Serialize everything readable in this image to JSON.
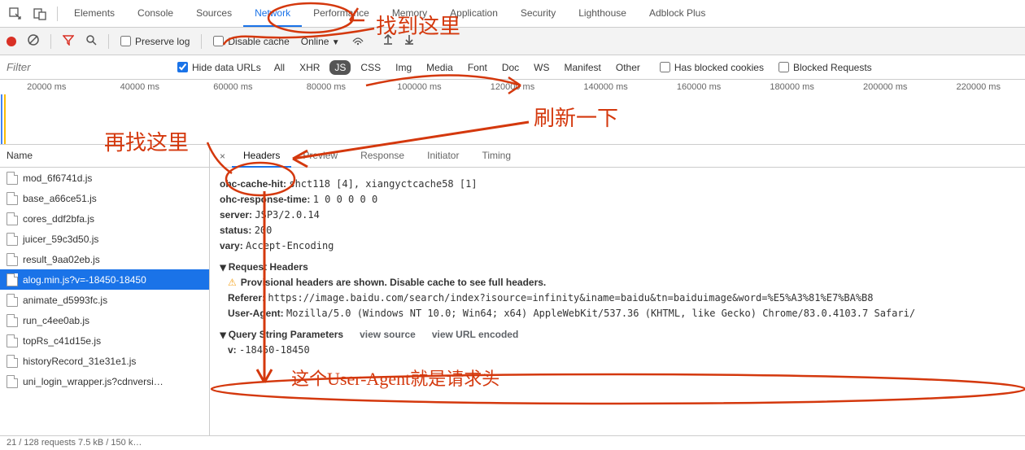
{
  "top_tabs": {
    "tabs": [
      "Elements",
      "Console",
      "Sources",
      "Network",
      "Performance",
      "Memory",
      "Application",
      "Security",
      "Lighthouse",
      "Adblock Plus"
    ],
    "active": "Network"
  },
  "toolbar": {
    "preserve_log": "Preserve log",
    "disable_cache": "Disable cache",
    "online": "Online"
  },
  "filter": {
    "placeholder": "Filter",
    "hide_data_urls": "Hide data URLs",
    "types": [
      "All",
      "XHR",
      "JS",
      "CSS",
      "Img",
      "Media",
      "Font",
      "Doc",
      "WS",
      "Manifest",
      "Other"
    ],
    "selected_type": "JS",
    "has_blocked_cookies": "Has blocked cookies",
    "blocked_requests": "Blocked Requests"
  },
  "timeline": {
    "ticks": [
      "20000 ms",
      "40000 ms",
      "60000 ms",
      "80000 ms",
      "100000 ms",
      "120000 ms",
      "140000 ms",
      "160000 ms",
      "180000 ms",
      "200000 ms",
      "220000 ms"
    ]
  },
  "left": {
    "header": "Name",
    "items": [
      "mod_6f6741d.js",
      "base_a66ce51.js",
      "cores_ddf2bfa.js",
      "juicer_59c3d50.js",
      "result_9aa02eb.js",
      "alog.min.js?v=-18450-18450",
      "animate_d5993fc.js",
      "run_c4ee0ab.js",
      "topRs_c41d15e.js",
      "historyRecord_31e31e1.js",
      "uni_login_wrapper.js?cdnversi…"
    ],
    "selected_index": 5
  },
  "status_bar": "21 / 128 requests    7.5 kB / 150 k…",
  "right": {
    "sub_tabs": [
      "Headers",
      "Preview",
      "Response",
      "Initiator",
      "Timing"
    ],
    "active": "Headers",
    "headers": {
      "ohc_cache_hit_label": "ohc-cache-hit:",
      "ohc_cache_hit_value": "shct118 [4], xiangyctcache58 [1]",
      "ohc_response_time_label": "ohc-response-time:",
      "ohc_response_time_value": "1 0 0 0 0 0",
      "server_label": "server:",
      "server_value": "JSP3/2.0.14",
      "status_label": "status:",
      "status_value": "200",
      "vary_label": "vary:",
      "vary_value": "Accept-Encoding"
    },
    "request_headers_title": "Request Headers",
    "provisional_warning": "Provisional headers are shown. Disable cache to see full headers.",
    "referer_label": "Referer:",
    "referer_value": "https://image.baidu.com/search/index?isource=infinity&iname=baidu&tn=baiduimage&word=%E5%A3%81%E7%BA%B8",
    "user_agent_label": "User-Agent:",
    "user_agent_value": "Mozilla/5.0 (Windows NT 10.0; Win64; x64) AppleWebKit/537.36 (KHTML, like Gecko) Chrome/83.0.4103.7 Safari/",
    "query_title": "Query String Parameters",
    "view_source": "view source",
    "view_url_encoded": "view URL encoded",
    "v_label": "v:",
    "v_value": "-18450-18450"
  },
  "annotations": {
    "a1": "找到这里",
    "a2": "刷新一下",
    "a3": "再找这里",
    "a4": "这个User-Agent就是请求头"
  }
}
